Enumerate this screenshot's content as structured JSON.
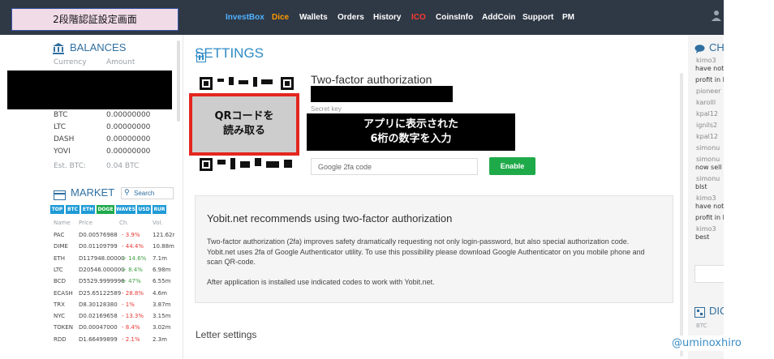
{
  "annotations": {
    "title": "2段階認証設定画面",
    "qr_note_line1": "QRコードを",
    "qr_note_line2": "読み取る",
    "enter_note_line1": "アプリに表示された",
    "enter_note_line2": "6桁の数字を入力",
    "watermark": "@uminoxhiro"
  },
  "nav": {
    "items": [
      "InvestBox",
      "Dice",
      "Wallets",
      "Orders",
      "History",
      "ICO",
      "CoinsInfo",
      "AddCoin",
      "Support",
      "PM"
    ],
    "colors": {
      "InvestBox": "#4fb3ff",
      "Dice": "#ff9900",
      "ICO": "#ff3b30",
      "default": "#ffffff"
    }
  },
  "balances": {
    "title": "BALANCES",
    "col_currency": "Currency",
    "col_amount": "Amount",
    "rows": [
      {
        "currency": "BTC",
        "amount": "0.00000000"
      },
      {
        "currency": "LTC",
        "amount": "0.00000000"
      },
      {
        "currency": "DASH",
        "amount": "0.00000000"
      },
      {
        "currency": "YOVI",
        "amount": "0.00000000"
      }
    ],
    "est_label": "Est. BTC:",
    "est_value": "0.04 BTC"
  },
  "market": {
    "title": "MARKET",
    "search_placeholder": "Search",
    "tabs": [
      "TOP",
      "BTC",
      "ETH",
      "DOGE",
      "WAVES",
      "USD",
      "RUR"
    ],
    "active_tab": "DOGE",
    "headers": [
      "Name",
      "Price",
      "Ch.",
      "Vol."
    ],
    "rows": [
      {
        "name": "PAC",
        "price": "D0.00576988",
        "change": "- 3.9%",
        "vol": "121.62r",
        "dir": "neg"
      },
      {
        "name": "DIME",
        "price": "D0.01109799",
        "change": "- 44.4%",
        "vol": "10.88m",
        "dir": "neg"
      },
      {
        "name": "ETH",
        "price": "D117948.00000",
        "change": "+ 14.6%",
        "vol": "7.1m",
        "dir": "pos"
      },
      {
        "name": "LTC",
        "price": "D20546.000000",
        "change": "+ 8.4%",
        "vol": "6.98m",
        "dir": "pos"
      },
      {
        "name": "BCD",
        "price": "D5529.9999996",
        "change": "+ 47%",
        "vol": "6.55m",
        "dir": "pos"
      },
      {
        "name": "ECASH",
        "price": "D25.65122589",
        "change": "- 28.8%",
        "vol": "4.6m",
        "dir": "neg"
      },
      {
        "name": "TRX",
        "price": "D8.30128380",
        "change": "- 1%",
        "vol": "3.87m",
        "dir": "neg"
      },
      {
        "name": "NYC",
        "price": "D0.02169658",
        "change": "- 13.3%",
        "vol": "3.15m",
        "dir": "neg"
      },
      {
        "name": "TOKEN",
        "price": "D0.00047000",
        "change": "- 8.4%",
        "vol": "3.02m",
        "dir": "neg"
      },
      {
        "name": "RDD",
        "price": "D1.66499899",
        "change": "- 2.1%",
        "vol": "2.3m",
        "dir": "neg"
      }
    ]
  },
  "settings": {
    "title": "SETTINGS",
    "tfa_title": "Two-factor authorization",
    "secret_label": "Secret key",
    "code_placeholder": "Google 2fa code",
    "enable_button": "Enable",
    "info_title": "Yobit.net recommends using two-factor authorization",
    "info_p1": "Two-factor authorization (2fa) improves safety dramatically requesting not only login-password, but also special authorization code. Yobit.net uses 2fa of Google Authenticator utility. To use this possibility please download Google Authenticator on you mobile phone and scan QR-code.",
    "info_p2": "After application is installed use indicated codes to work with Yobit.net.",
    "letter_settings": "Letter settings"
  },
  "chat": {
    "title": "CH",
    "messages": [
      {
        "user": "kimo3",
        "text": "have not"
      },
      {
        "user": "",
        "text": "profit in l"
      },
      {
        "user": "pioneer",
        "text": ""
      },
      {
        "user": "karolll",
        "text": ""
      },
      {
        "user": "kpal12",
        "text": ""
      },
      {
        "user": "ignils2",
        "text": ""
      },
      {
        "user": "kpal12",
        "text": ""
      },
      {
        "user": "simonu",
        "text": ""
      },
      {
        "user": "simonu",
        "text": "now sell"
      },
      {
        "user": "simonu",
        "text": "blst"
      },
      {
        "user": "kimo3",
        "text": "have not"
      },
      {
        "user": "",
        "text": "profit in l"
      },
      {
        "user": "kimo3",
        "text": "best"
      }
    ],
    "dice_title": "DIC",
    "dice_sub": "BTC"
  }
}
